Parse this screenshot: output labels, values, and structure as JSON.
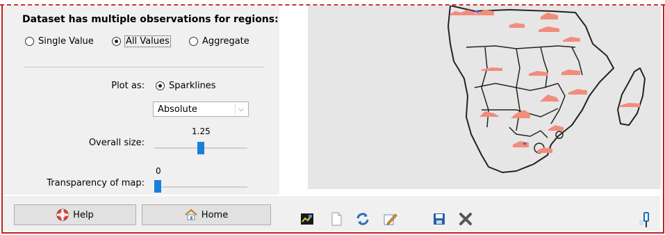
{
  "panel": {
    "heading": "Dataset has multiple observations for regions:",
    "radios": [
      {
        "label": "Single Value",
        "selected": false
      },
      {
        "label": "All Values",
        "selected": true
      },
      {
        "label": "Aggregate",
        "selected": false
      }
    ],
    "plot_as_label": "Plot as:",
    "plot_as_option": "Sparklines",
    "mode_select_value": "Absolute",
    "overall_size_label": "Overall size:",
    "overall_size_value": "1.25",
    "transparency_label": "Transparency of map:",
    "transparency_value": "0"
  },
  "buttons": {
    "help": "Help",
    "home": "Home"
  },
  "toolbar_icons": [
    "chart-icon",
    "new-document-icon",
    "refresh-icon",
    "edit-icon",
    "save-icon",
    "close-icon"
  ],
  "colors": {
    "sparkline": "#f28c7c",
    "slider_thumb": "#1a7fdc",
    "map_land": "#e6e6e6",
    "border_accent": "#bb2222"
  }
}
